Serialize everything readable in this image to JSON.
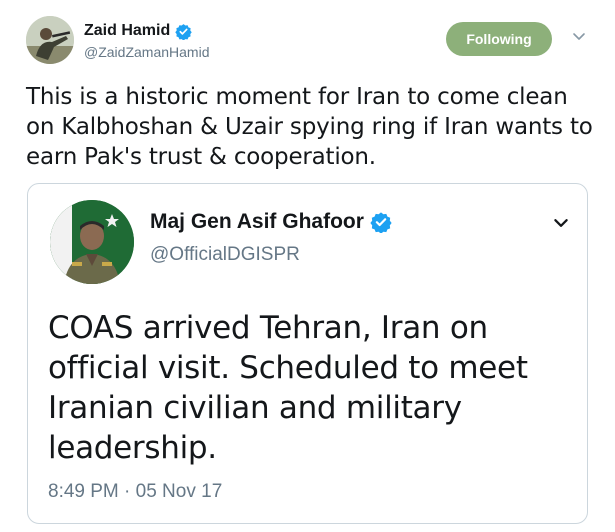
{
  "tweet": {
    "author": {
      "display_name": "Zaid Hamid",
      "handle": "@ZaidZamanHamid",
      "verified": true
    },
    "follow_button_label": "Following",
    "text": "This is a historic moment for Iran to come clean on Kalbhoshan & Uzair spying ring if Iran wants to earn Pak's trust & cooperation."
  },
  "quoted_tweet": {
    "author": {
      "display_name": "Maj Gen Asif Ghafoor",
      "handle": "@OfficialDGISPR",
      "verified": true
    },
    "text": "COAS arrived Tehran, Iran on official visit. Scheduled to meet Iranian civilian and military leadership.",
    "timestamp": "8:49 PM · 05 Nov 17"
  },
  "icons": {
    "verified": "verified-badge-icon",
    "caret": "chevron-down-icon"
  },
  "colors": {
    "follow_button": "#8db07a",
    "verified": "#1da1f2",
    "muted_text": "#657786",
    "border": "#ccd6dd"
  }
}
